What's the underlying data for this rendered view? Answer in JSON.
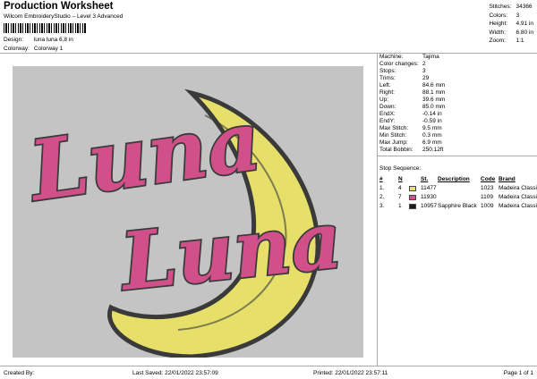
{
  "header": {
    "title": "Production Worksheet",
    "subtitle": "Wilcom EmbroideryStudio – Level 3 Advanced",
    "design_label": "Design:",
    "design_value": "luna luna 6,8 in",
    "colorway_label": "Colorway:",
    "colorway_value": "Colorway 1"
  },
  "stats": [
    {
      "label": "Stitches:",
      "value": "34366"
    },
    {
      "label": "Colors:",
      "value": "3"
    },
    {
      "label": "Height:",
      "value": "4.91 in"
    },
    {
      "label": "Width:",
      "value": "6.80 in"
    },
    {
      "label": "Zoom:",
      "value": "1:1"
    }
  ],
  "machine_info": [
    {
      "label": "Machine:",
      "value": "Tajima"
    },
    {
      "label": "Color changes:",
      "value": "2"
    },
    {
      "label": "Stops:",
      "value": "3"
    },
    {
      "label": "Trims:",
      "value": "29"
    },
    {
      "label": "Left:",
      "value": "84.6 mm"
    },
    {
      "label": "Right:",
      "value": "88.1 mm"
    },
    {
      "label": "Up:",
      "value": "39.6 mm"
    },
    {
      "label": "Down:",
      "value": "85.0 mm"
    },
    {
      "label": "EndX:",
      "value": "-0.14 in"
    },
    {
      "label": "EndY:",
      "value": "-0.59 in"
    },
    {
      "label": "Max Stitch:",
      "value": "9.5 mm"
    },
    {
      "label": "Min Stitch:",
      "value": "0.3 mm"
    },
    {
      "label": "Max Jump:",
      "value": "6.9 mm"
    },
    {
      "label": "Total Bobbin:",
      "value": "250.12ft"
    }
  ],
  "stop_sequence": {
    "title": "Stop Sequence:",
    "headers": {
      "num": "#",
      "n": "N",
      "st": "St.",
      "desc": "Description",
      "code": "Code",
      "brand": "Brand"
    },
    "rows": [
      {
        "num": "1.",
        "n": "4",
        "color": "#e6df6a",
        "st": "11477",
        "desc": "",
        "code": "1023",
        "brand": "Madeira Classic 40"
      },
      {
        "num": "2.",
        "n": "7",
        "color": "#d2508a",
        "st": "11930",
        "desc": "",
        "code": "1109",
        "brand": "Madeira Classic 40"
      },
      {
        "num": "3.",
        "n": "1",
        "color": "#1c1c1c",
        "st": "10957",
        "desc": "Sapphire Black",
        "code": "1009",
        "brand": "Madeira Classic 40"
      }
    ]
  },
  "design_text": {
    "line1": "Luna",
    "line2": "Luna"
  },
  "colors": {
    "canvas": "#c4c4c4",
    "moon": "#e6df6a",
    "moon_outline": "#3a3a3a",
    "text_fill": "#d2508a"
  },
  "footer": {
    "created_by": "Created By:",
    "last_saved": "Last Saved: 22/01/2022 23:57:09",
    "printed": "Printed: 22/01/2022 23:57:11",
    "page": "Page 1 of 1"
  }
}
